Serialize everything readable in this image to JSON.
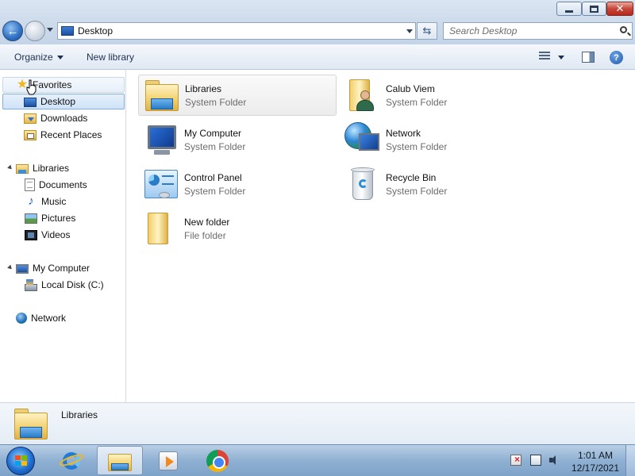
{
  "window": {
    "minimize_label": "",
    "maximize_label": "",
    "close_label": "✕"
  },
  "navigation": {
    "back_symbol": "←",
    "address": "Desktop",
    "refresh_symbol": "⇆",
    "search_placeholder": "Search Desktop"
  },
  "toolbar": {
    "organize_label": "Organize",
    "new_library_label": "New library",
    "help_symbol": "?"
  },
  "nav_pane": {
    "favorites": {
      "label": "Favorites",
      "items": [
        "Desktop",
        "Downloads",
        "Recent Places"
      ]
    },
    "libraries": {
      "label": "Libraries",
      "items": [
        "Documents",
        "Music",
        "Pictures",
        "Videos"
      ]
    },
    "computer": {
      "label": "My Computer",
      "items": [
        "Local Disk (C:)"
      ]
    },
    "network": {
      "label": "Network"
    },
    "selected_item": "Desktop"
  },
  "content": {
    "items": [
      {
        "name": "Libraries",
        "type": "System Folder",
        "icon": "libraries-icon"
      },
      {
        "name": "Calub Viem",
        "type": "System Folder",
        "icon": "user-folder-icon"
      },
      {
        "name": "My Computer",
        "type": "System Folder",
        "icon": "computer-icon"
      },
      {
        "name": "Network",
        "type": "System Folder",
        "icon": "network-icon"
      },
      {
        "name": "Control Panel",
        "type": "System Folder",
        "icon": "control-panel-icon"
      },
      {
        "name": "Recycle Bin",
        "type": "System Folder",
        "icon": "recycle-bin-icon"
      },
      {
        "name": "New folder",
        "type": "File folder",
        "icon": "folder-icon"
      }
    ],
    "selected_item": "Libraries"
  },
  "details": {
    "name": "Libraries"
  },
  "taskbar": {
    "apps": [
      "internet-explorer",
      "windows-explorer",
      "media-player",
      "chrome"
    ],
    "active_app": "windows-explorer",
    "time": "1:01 AM",
    "date": "12/17/2021"
  },
  "colors": {
    "selection_border": "#84acdd",
    "secondary_text": "#6d6d6d",
    "taskbar": "#8fb0d2"
  }
}
